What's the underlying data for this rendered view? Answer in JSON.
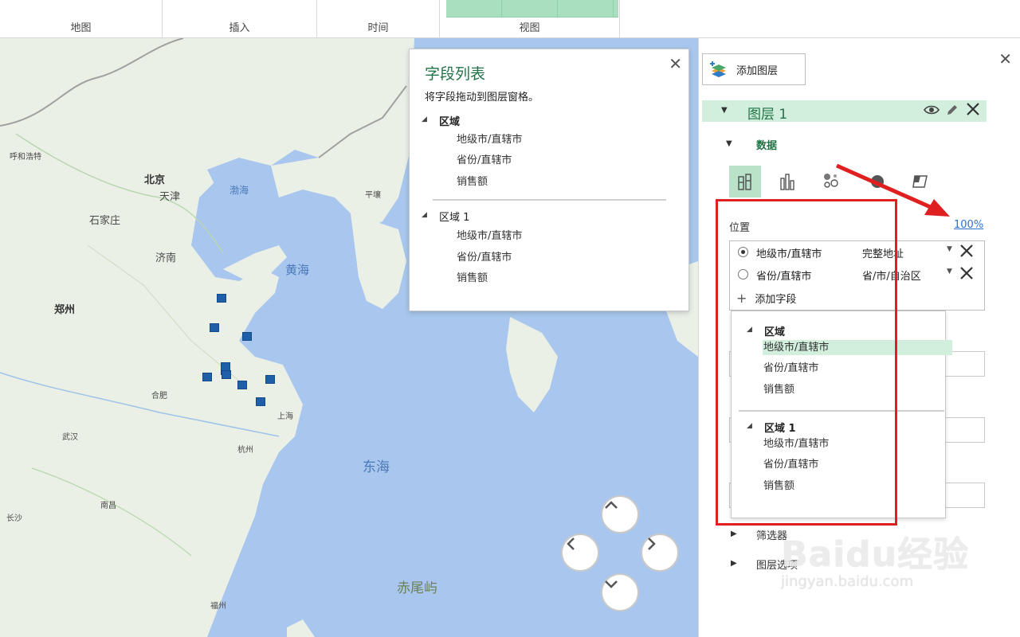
{
  "ribbon": {
    "groups": [
      {
        "label": "地图"
      },
      {
        "label": "插入"
      },
      {
        "label": "时间"
      },
      {
        "label": "视图"
      }
    ]
  },
  "map": {
    "cities": [
      {
        "name": "呼和浩特"
      },
      {
        "name": "北京"
      },
      {
        "name": "天津"
      },
      {
        "name": "石家庄"
      },
      {
        "name": "济南"
      },
      {
        "name": "郑州"
      },
      {
        "name": "合肥"
      },
      {
        "name": "上海"
      },
      {
        "name": "杭州"
      },
      {
        "name": "武汉"
      },
      {
        "name": "南昌"
      },
      {
        "name": "长沙"
      },
      {
        "name": "福州"
      },
      {
        "name": "平壤"
      }
    ],
    "seas": {
      "bohai": "渤海",
      "yellow": "黄海",
      "east": "东海",
      "chiwei": "赤尾屿"
    }
  },
  "field_list": {
    "title": "字段列表",
    "description": "将字段拖动到图层窗格。",
    "close": "✕",
    "groups": [
      {
        "name": "区域",
        "items": [
          "地级市/直辖市",
          "省份/直辖市",
          "销售额"
        ]
      },
      {
        "name": "区域 1",
        "items": [
          "地级市/直辖市",
          "省份/直辖市",
          "销售额"
        ]
      }
    ]
  },
  "pane": {
    "close": "✕",
    "add_layer": "添加图层",
    "layer_name": "图层 1",
    "data_section": "数据",
    "position_label": "位置",
    "percent": "100%",
    "fields": [
      {
        "name": "地级市/直辖市",
        "type": "完整地址",
        "selected": true
      },
      {
        "name": "省份/直辖市",
        "type": "省/市/自治区",
        "selected": false
      }
    ],
    "add_field": "添加字段",
    "dropdown": {
      "groups": [
        {
          "name": "区域",
          "items": [
            "地级市/直辖市",
            "省份/直辖市",
            "销售额"
          ],
          "selected_index": 0
        },
        {
          "name": "区域 1",
          "items": [
            "地级市/直辖市",
            "省份/直辖市",
            "销售额"
          ]
        }
      ]
    },
    "filter_section": "筛选器",
    "layer_options_section": "图层选项"
  },
  "watermark": {
    "main": "Baidu经验",
    "sub": "jingyan.baidu.com"
  },
  "colors": {
    "accent_green": "#217346",
    "layer_bar": "#d2eedd",
    "highlight_red": "#e02020",
    "marker_blue": "#1f5fa8"
  }
}
